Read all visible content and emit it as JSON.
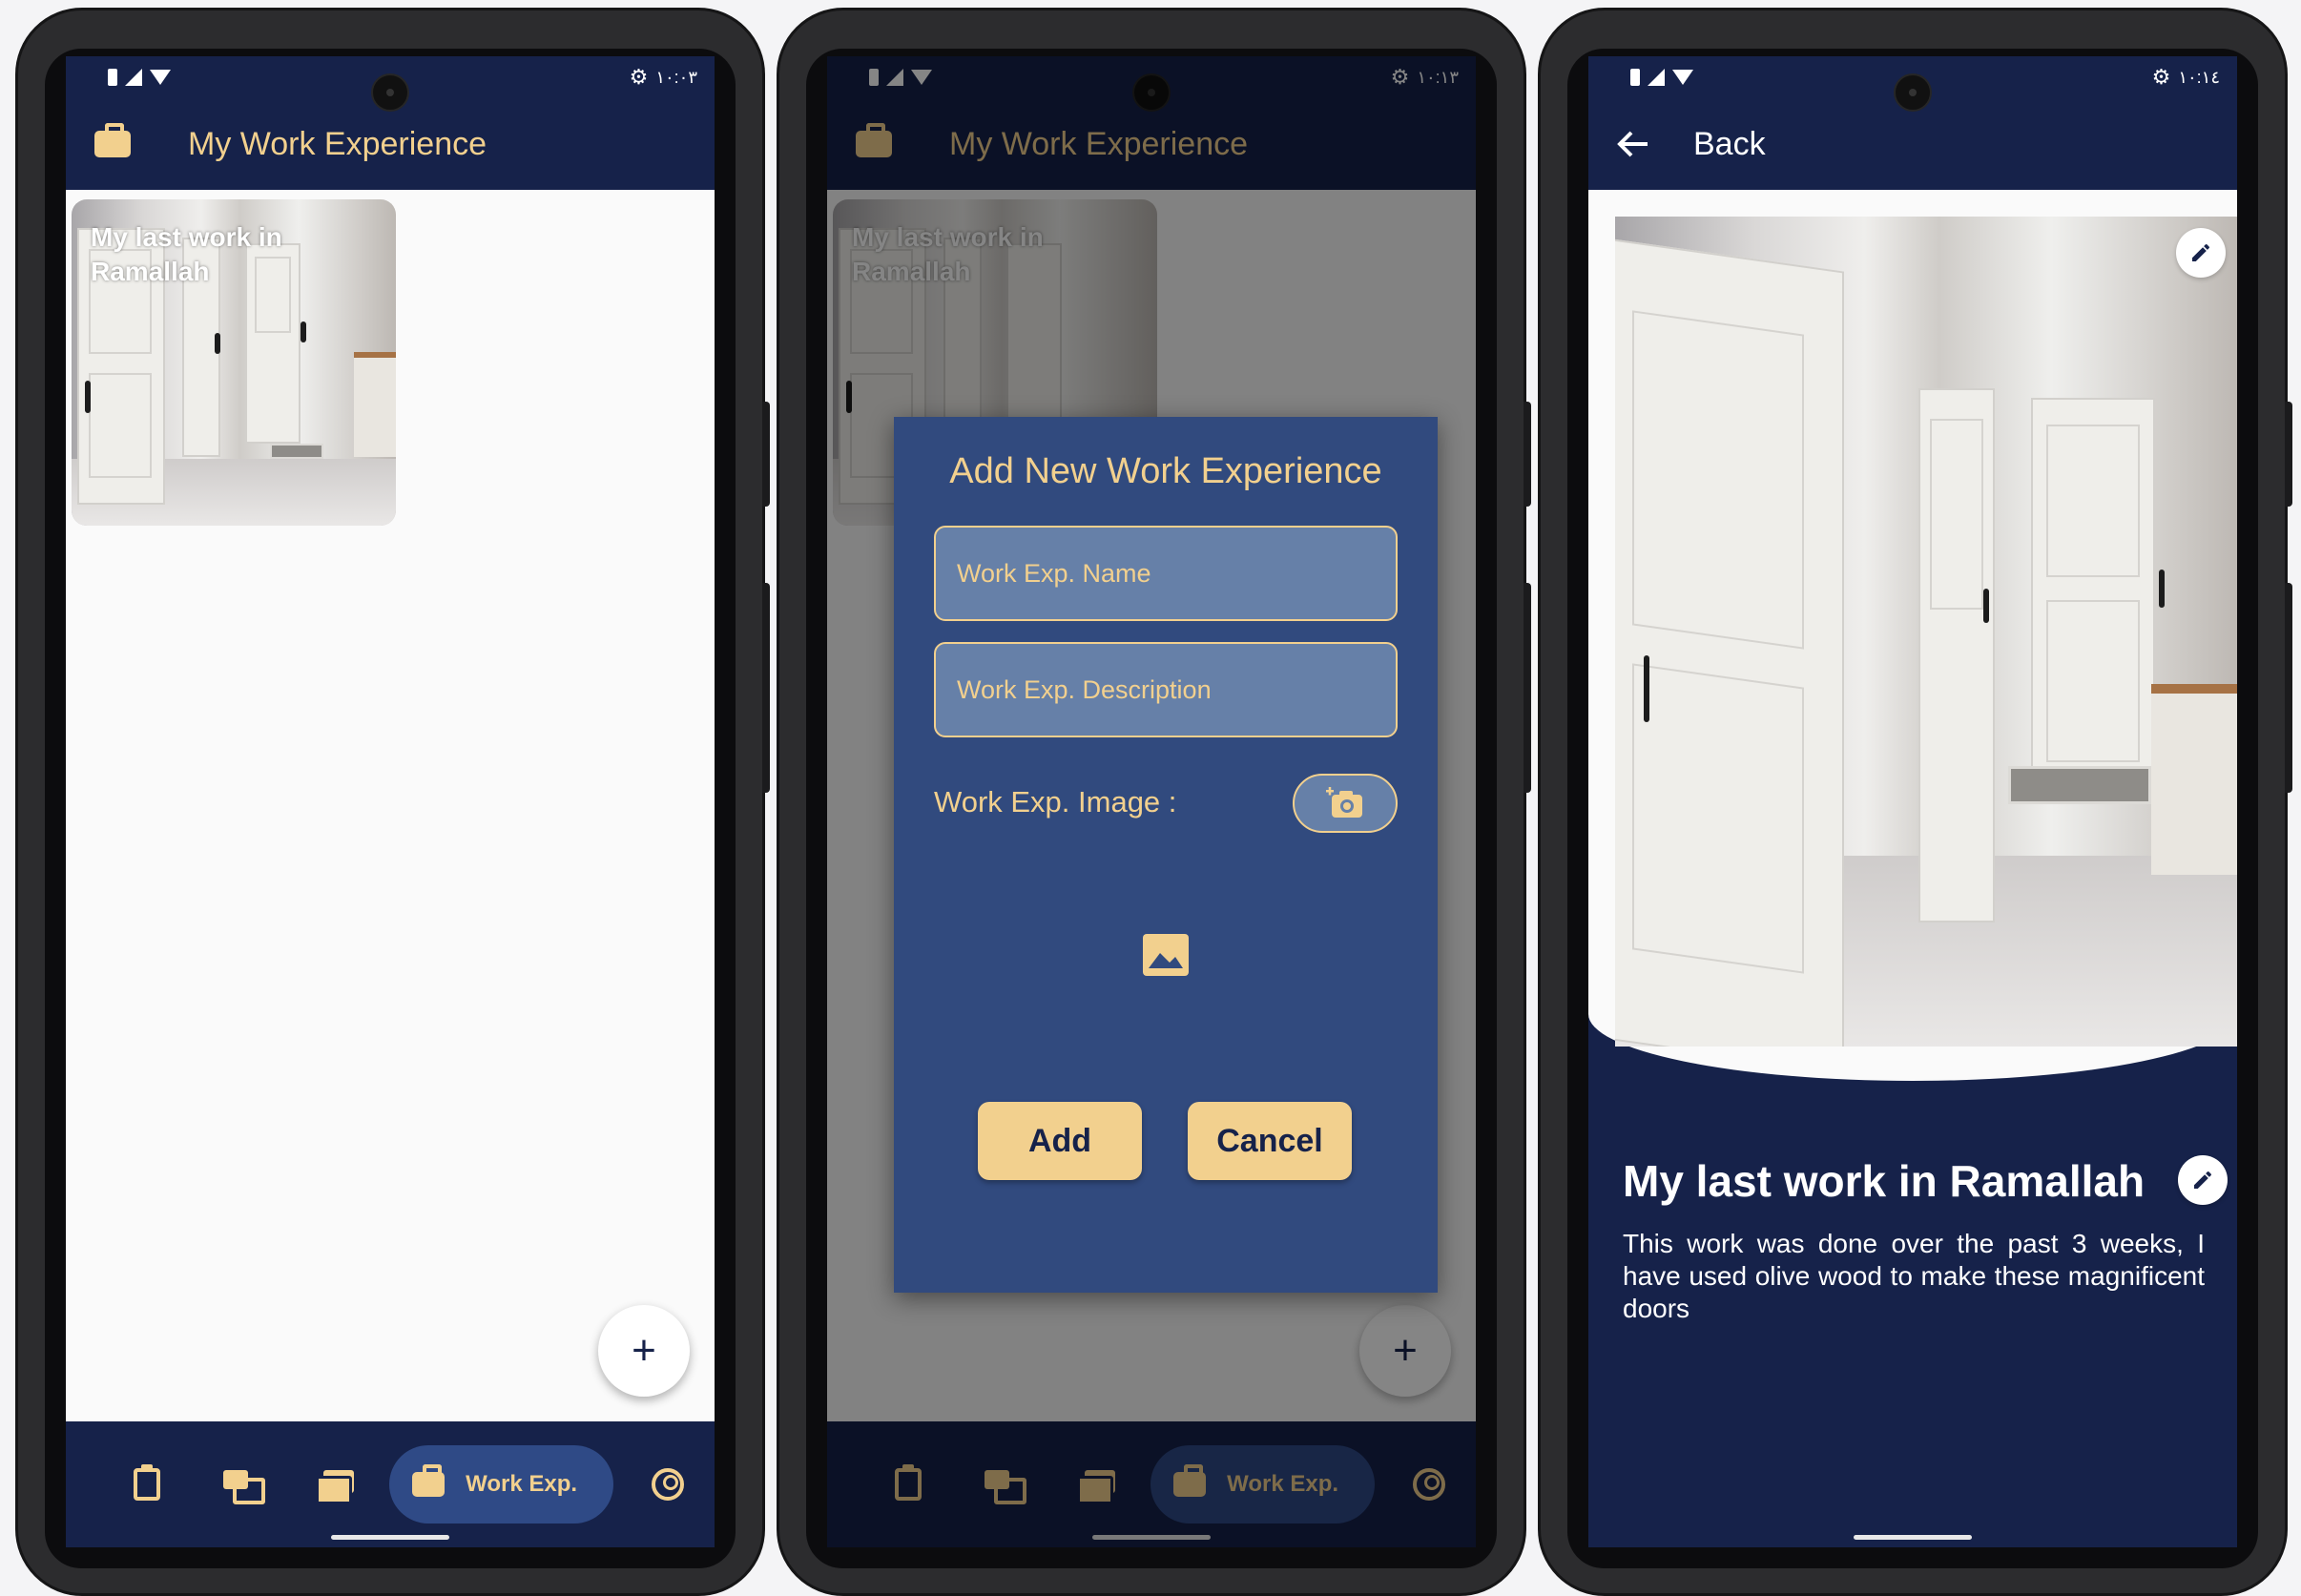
{
  "screen1": {
    "status": {
      "time": "١٠:٠٣"
    },
    "appbar": {
      "title": "My Work Experience",
      "icon": "briefcase-icon"
    },
    "cards": [
      {
        "title": "My last work in Ramallah"
      }
    ],
    "fab": {
      "label": "+"
    },
    "nav": {
      "items": [
        "clipboard-icon",
        "chat-icon",
        "folders-icon",
        "briefcase-icon",
        "account-icon"
      ],
      "active_label": "Work Exp."
    }
  },
  "screen2": {
    "status": {
      "time": "١٠:١٣"
    },
    "appbar": {
      "title": "My Work Experience"
    },
    "cards": [
      {
        "title": "My last work in Ramallah"
      }
    ],
    "dialog": {
      "title": "Add New Work Experience",
      "name_placeholder": "Work Exp. Name",
      "description_placeholder": "Work Exp. Description",
      "image_label": "Work Exp. Image :",
      "add_label": "Add",
      "cancel_label": "Cancel"
    },
    "fab": {
      "label": "+"
    },
    "nav": {
      "active_label": "Work Exp."
    }
  },
  "screen3": {
    "status": {
      "time": "١٠:١٤"
    },
    "appbar": {
      "back_label": "Back"
    },
    "detail": {
      "title": "My last work in Ramallah",
      "description": "This work was done over the past 3 weeks, I have used olive wood to make these magnificent doors"
    }
  },
  "colors": {
    "navy": "#16224a",
    "accent": "#f2d08e",
    "dialog": "#314a7e",
    "nav_active": "#2f4a86"
  }
}
